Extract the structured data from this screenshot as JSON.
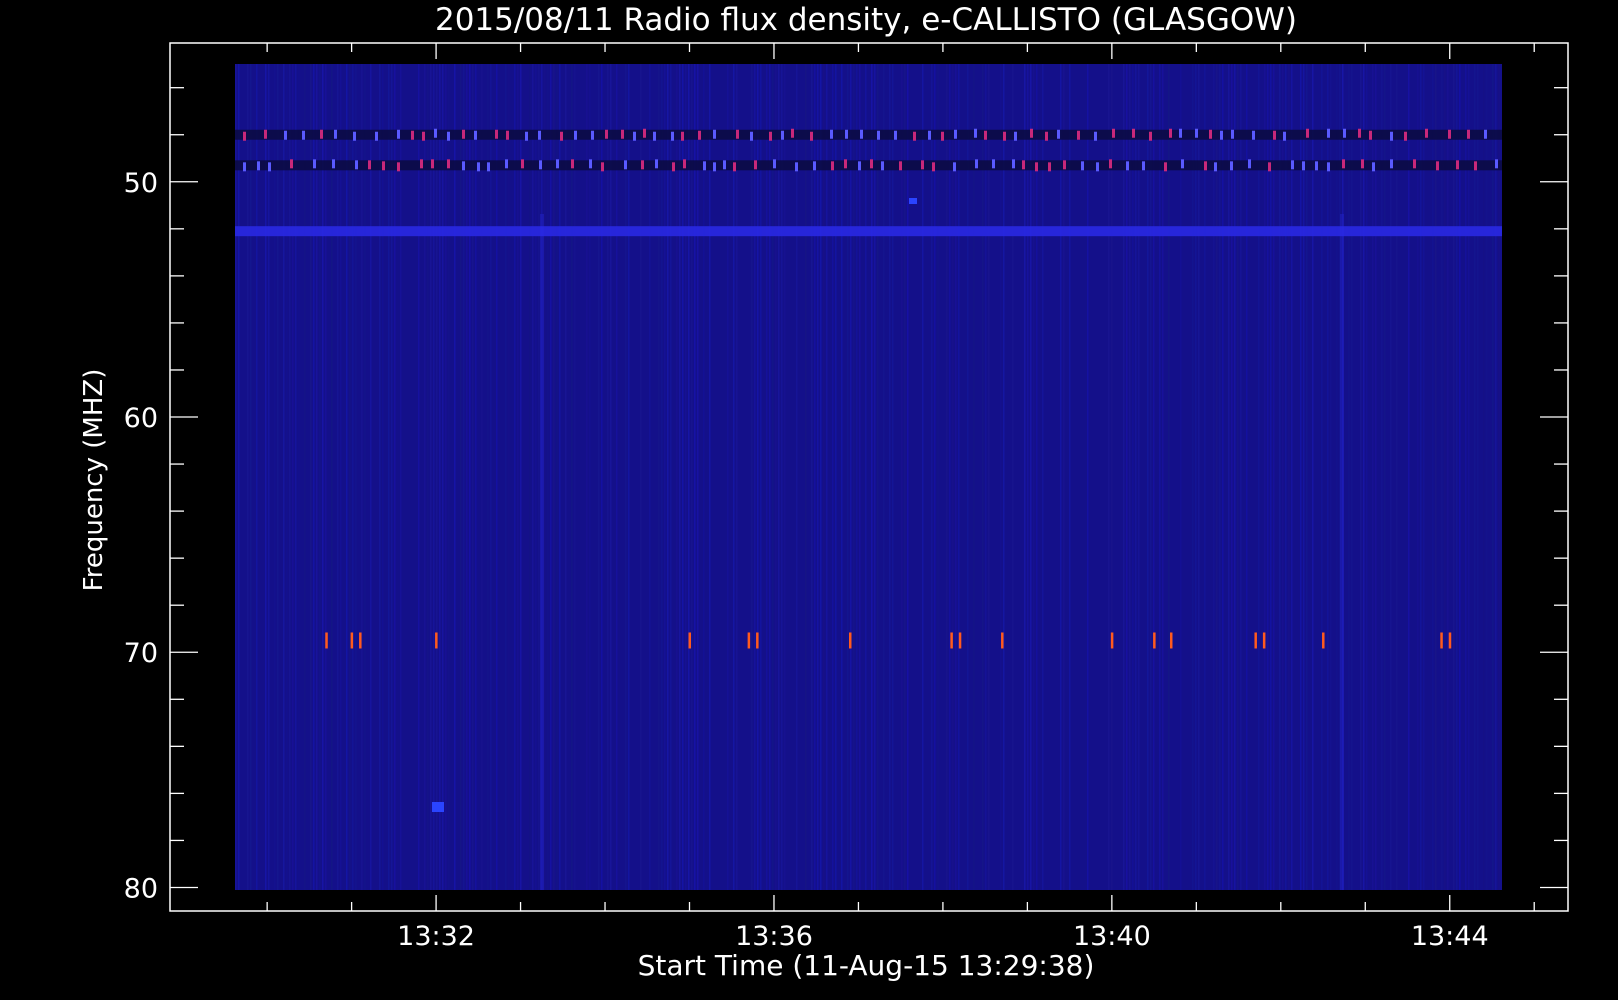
{
  "chart_data": {
    "type": "heatmap",
    "title": "2015/08/11  Radio flux density, e-CALLISTO (GLASGOW)",
    "xlabel": "Start Time (11-Aug-15 13:29:38)",
    "ylabel": "Frequency (MHZ)",
    "x_ticks": [
      "13:32",
      "13:36",
      "13:40",
      "13:44"
    ],
    "x_tick_minutes": [
      32,
      36,
      40,
      44
    ],
    "y_ticks": [
      50,
      60,
      70,
      80
    ],
    "xlim_minutes": [
      29.6,
      45.0
    ],
    "axis_xlim_minutes": [
      28.85,
      45.4
    ],
    "ylim": [
      44.1,
      81.0
    ],
    "axis_ylim": [
      44.1,
      81.0
    ],
    "y_inverted": true,
    "grid": false,
    "colors": {
      "background": "#000000",
      "axes": "#ffffff",
      "field_low": "#14108a",
      "field_high": "#2a2ae8",
      "interference": "#ff5a1e",
      "band_magenta": "#c8287a"
    },
    "bands": [
      {
        "freq_mhz": 48.0,
        "kind": "interference-dashes"
      },
      {
        "freq_mhz": 49.3,
        "kind": "interference-dashes"
      },
      {
        "freq_mhz": 52.1,
        "kind": "bright-stripe"
      },
      {
        "freq_mhz": 69.5,
        "kind": "sparse-spikes"
      }
    ],
    "spikes_minutes": [
      30.7,
      31.0,
      31.1,
      32.0,
      35.0,
      35.7,
      35.8,
      36.9,
      38.1,
      38.2,
      38.7,
      40.0,
      40.5,
      40.7,
      41.7,
      41.8,
      42.5,
      43.9,
      44.0
    ]
  }
}
